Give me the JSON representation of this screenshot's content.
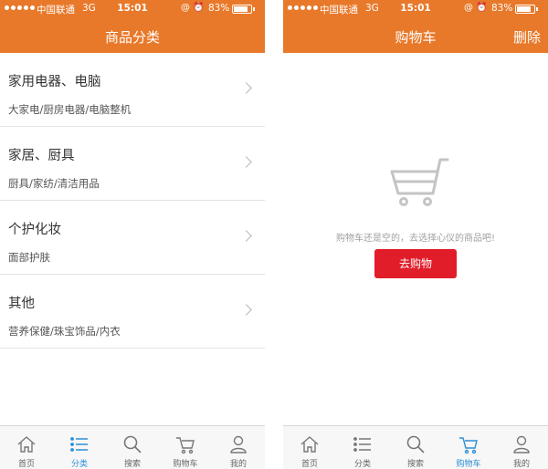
{
  "status_bar": {
    "carrier": "中国联通",
    "network": "3G",
    "time": "15:01",
    "battery": "83%",
    "icons": "@ ⏰"
  },
  "left_screen": {
    "title": "商品分类",
    "categories": [
      {
        "title": "家用电器、电脑",
        "subtitle": "大家电/厨房电器/电脑整机"
      },
      {
        "title": "家居、厨具",
        "subtitle": "厨具/家纺/清洁用品"
      },
      {
        "title": "个护化妆",
        "subtitle": "面部护肤"
      },
      {
        "title": "其他",
        "subtitle": "营养保健/珠宝饰品/内衣"
      }
    ]
  },
  "right_screen": {
    "title": "购物车",
    "action": "删除",
    "empty_message": "购物车还是空的，去选择心仪的商品吧!",
    "go_shopping": "去购物"
  },
  "tabs": [
    {
      "label": "首页",
      "icon": "home-icon"
    },
    {
      "label": "分类",
      "icon": "list-icon"
    },
    {
      "label": "搜索",
      "icon": "search-icon"
    },
    {
      "label": "购物车",
      "icon": "cart-icon"
    },
    {
      "label": "我的",
      "icon": "user-icon"
    }
  ],
  "colors": {
    "header": "#e8792a",
    "tab_active": "#2a8fd4",
    "button": "#e21d2a"
  }
}
